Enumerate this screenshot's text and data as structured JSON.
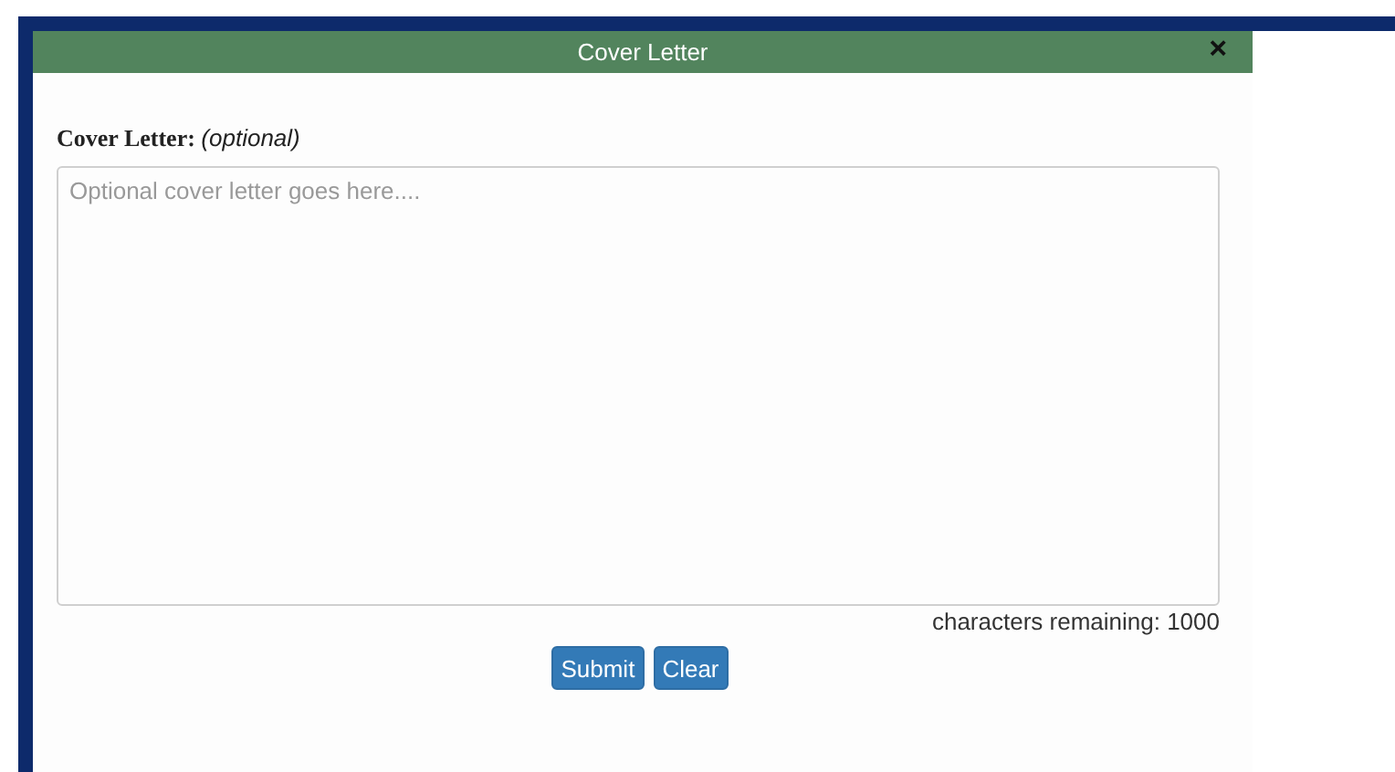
{
  "dialog": {
    "title": "Cover Letter",
    "close": "×"
  },
  "field": {
    "label": "Cover Letter:",
    "note": "(optional)",
    "placeholder": "Optional cover letter goes here....",
    "counter": "characters remaining: 1000"
  },
  "buttons": [
    {
      "label": "Submit"
    },
    {
      "label": "Clear"
    }
  ]
}
